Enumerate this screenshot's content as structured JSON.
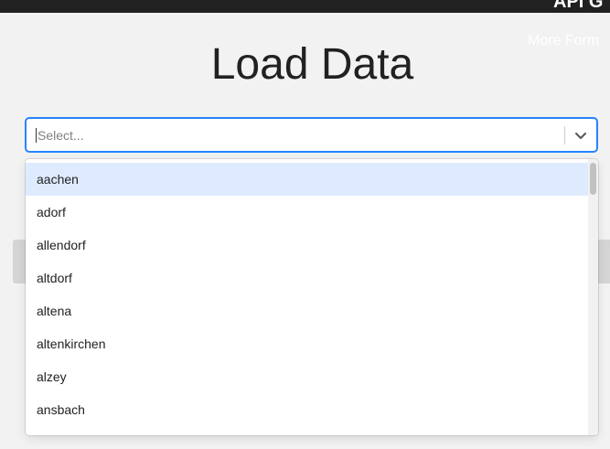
{
  "header": {
    "app_title": "API G",
    "more_link": "More Form"
  },
  "page": {
    "title": "Load Data"
  },
  "select": {
    "placeholder": "Select...",
    "menu_open": true,
    "focused_option_index": 0,
    "options": [
      "aachen",
      "adorf",
      "allendorf",
      "altdorf",
      "altena",
      "altenkirchen",
      "alzey",
      "ansbach"
    ]
  },
  "colors": {
    "focus_border": "#2684ff",
    "option_focus_bg": "#deebff",
    "topbar": "#212121"
  },
  "icons": {
    "dropdown_indicator": "chevron-down-icon"
  }
}
